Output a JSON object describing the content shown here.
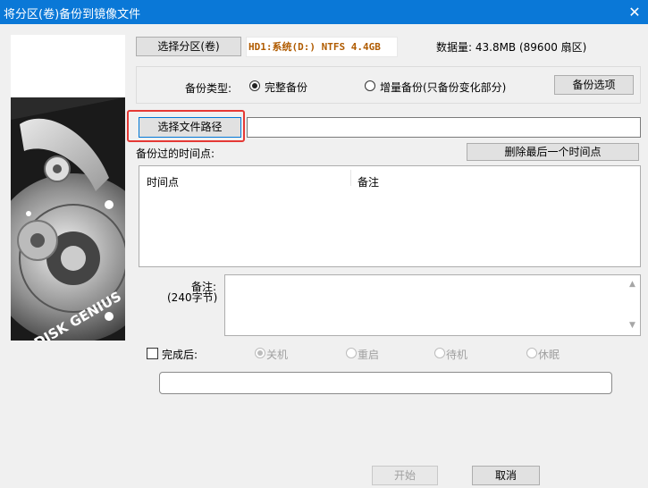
{
  "window": {
    "title": "将分区(卷)备份到镜像文件",
    "close_glyph": "✕"
  },
  "partition": {
    "select_button": "选择分区(卷)",
    "info": "HD1:系统(D:) NTFS 4.4GB",
    "data_size": "数据量: 43.8MB (89600 扇区)"
  },
  "backup_type": {
    "label": "备份类型:",
    "full": "完整备份",
    "incremental": "增量备份(只备份变化部分)",
    "selected": "full",
    "options_button": "备份选项"
  },
  "file_path": {
    "button": "选择文件路径",
    "value": ""
  },
  "timepoints": {
    "label": "备份过的时间点:",
    "delete_button": "删除最后一个时间点",
    "columns": [
      "时间点",
      "备注"
    ],
    "rows": []
  },
  "notes": {
    "label_line1": "备注:",
    "label_line2": "(240字节)",
    "value": ""
  },
  "after_complete": {
    "label": "完成后:",
    "checked": false,
    "options": [
      "关机",
      "重启",
      "待机",
      "休眠"
    ],
    "selected": "关机"
  },
  "progress": {
    "value": 0
  },
  "footer": {
    "start_button": "开始",
    "cancel_button": "取消"
  },
  "brand": {
    "image_text": "DISK GENIUS"
  },
  "colors": {
    "titlebar": "#0a78d7",
    "highlight": "#e53935",
    "partition_text": "#b05b00"
  }
}
